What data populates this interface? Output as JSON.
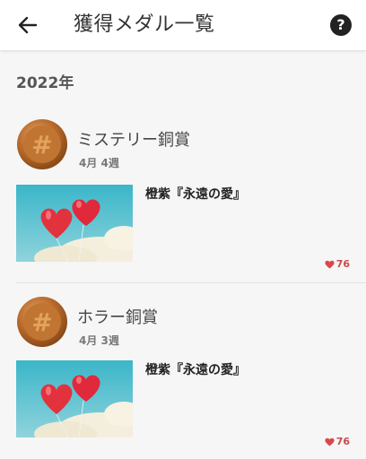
{
  "header": {
    "title": "獲得メダル一覧",
    "back_icon": "arrow-left-icon",
    "help_label": "?"
  },
  "year_label": "2022年",
  "colors": {
    "accent_like": "#d84a4a",
    "medal_bronze": "#b8692a"
  },
  "medals": [
    {
      "name": "ミステリー銅賞",
      "date": "4月 4週",
      "work_title": "橙紫『永遠の愛』",
      "likes": "76"
    },
    {
      "name": "ホラー銅賞",
      "date": "4月 3週",
      "work_title": "橙紫『永遠の愛』",
      "likes": "76"
    }
  ]
}
